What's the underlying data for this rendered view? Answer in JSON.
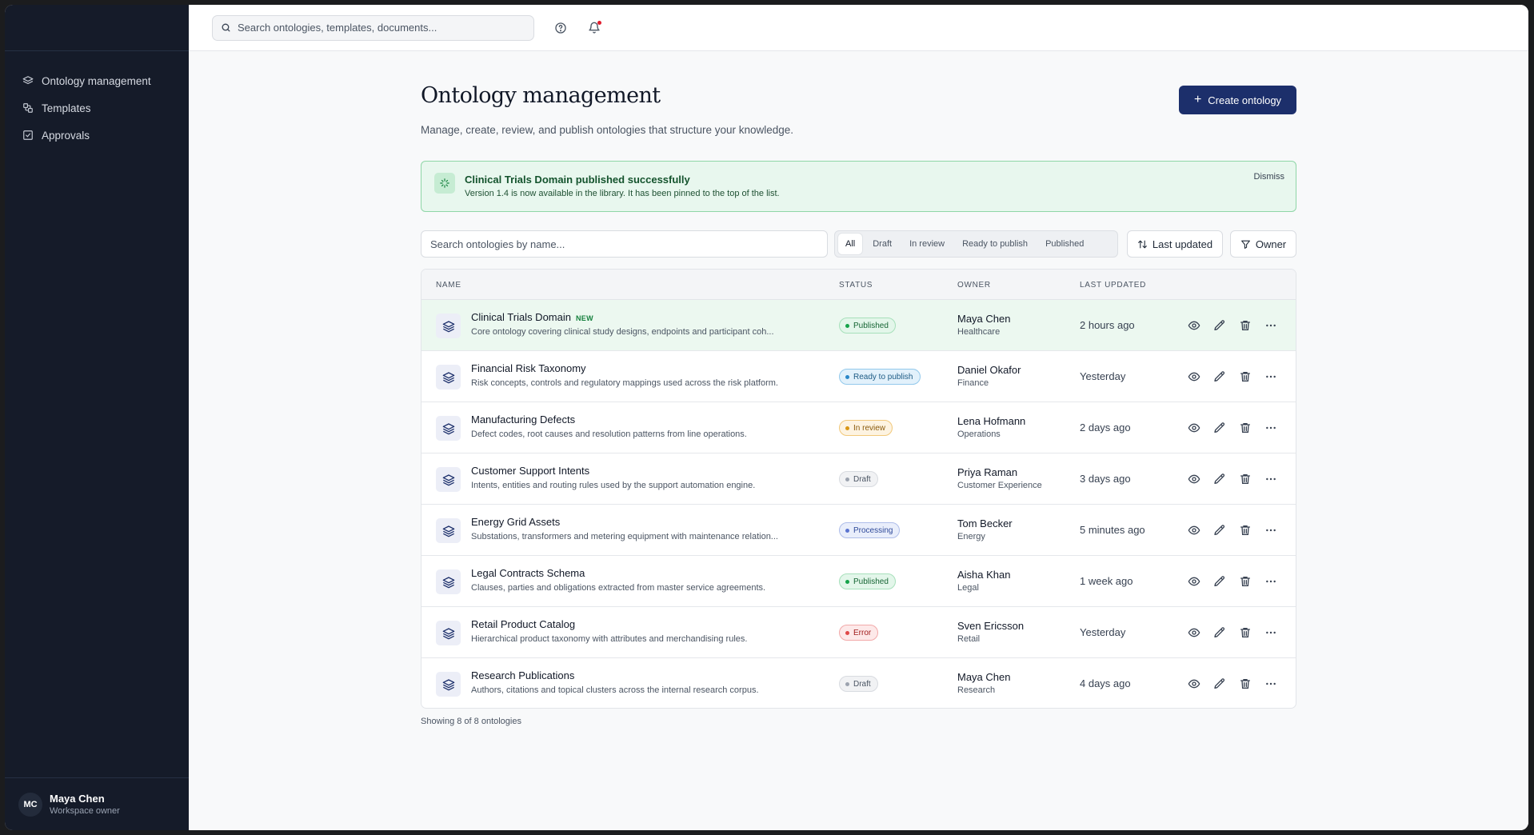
{
  "sidebar": {
    "items": [
      {
        "label": "Ontology management",
        "icon": "layers-icon"
      },
      {
        "label": "Templates",
        "icon": "template-icon"
      },
      {
        "label": "Approvals",
        "icon": "check-square-icon"
      }
    ],
    "user": {
      "initials": "MC",
      "name": "Maya Chen",
      "role": "Workspace owner"
    }
  },
  "topbar": {
    "search_placeholder": "Search ontologies, templates, documents...",
    "icons": [
      "help-icon",
      "bell-icon"
    ]
  },
  "page": {
    "title": "Ontology management",
    "subtitle": "Manage, create, review, and publish ontologies that structure your knowledge.",
    "create_label": "Create ontology"
  },
  "banner": {
    "title": "Clinical Trials Domain published successfully",
    "text": "Version 1.4 is now available in the library. It has been pinned to the top of the list.",
    "dismiss_label": "Dismiss"
  },
  "filters": {
    "search_placeholder": "Search ontologies by name...",
    "tabs": [
      "All",
      "Draft",
      "In review",
      "Ready to publish",
      "Published"
    ],
    "active_tab": "All",
    "sort_label": "Last updated",
    "owner_label": "Owner"
  },
  "table": {
    "columns": [
      "NAME",
      "STATUS",
      "OWNER",
      "LAST UPDATED"
    ],
    "rows": [
      {
        "name": "Clinical Trials Domain",
        "badge": "NEW",
        "description": "Core ontology covering clinical study designs, endpoints and participant coh...",
        "status": "Published",
        "owner": "Maya Chen",
        "dept": "Healthcare",
        "updated": "2 hours ago",
        "highlight": true
      },
      {
        "name": "Financial Risk Taxonomy",
        "badge": "",
        "description": "Risk concepts, controls and regulatory mappings used across the risk platform.",
        "status": "Ready to publish",
        "owner": "Daniel Okafor",
        "dept": "Finance",
        "updated": "Yesterday",
        "highlight": false
      },
      {
        "name": "Manufacturing Defects",
        "badge": "",
        "description": "Defect codes, root causes and resolution patterns from line operations.",
        "status": "In review",
        "owner": "Lena Hofmann",
        "dept": "Operations",
        "updated": "2 days ago",
        "highlight": false
      },
      {
        "name": "Customer Support Intents",
        "badge": "",
        "description": "Intents, entities and routing rules used by the support automation engine.",
        "status": "Draft",
        "owner": "Priya Raman",
        "dept": "Customer Experience",
        "updated": "3 days ago",
        "highlight": false
      },
      {
        "name": "Energy Grid Assets",
        "badge": "",
        "description": "Substations, transformers and metering equipment with maintenance relation...",
        "status": "Processing",
        "owner": "Tom Becker",
        "dept": "Energy",
        "updated": "5 minutes ago",
        "highlight": false
      },
      {
        "name": "Legal Contracts Schema",
        "badge": "",
        "description": "Clauses, parties and obligations extracted from master service agreements.",
        "status": "Published",
        "owner": "Aisha Khan",
        "dept": "Legal",
        "updated": "1 week ago",
        "highlight": false
      },
      {
        "name": "Retail Product Catalog",
        "badge": "",
        "description": "Hierarchical product taxonomy with attributes and merchandising rules.",
        "status": "Error",
        "owner": "Sven Ericsson",
        "dept": "Retail",
        "updated": "Yesterday",
        "highlight": false
      },
      {
        "name": "Research Publications",
        "badge": "",
        "description": "Authors, citations and topical clusters across the internal research corpus.",
        "status": "Draft",
        "owner": "Maya Chen",
        "dept": "Research",
        "updated": "4 days ago",
        "highlight": false
      }
    ],
    "row_actions": [
      "eye-icon",
      "pencil-icon",
      "trash-icon",
      "more-horizontal-icon"
    ]
  },
  "status_colors": {
    "Published": {
      "bg": "#e3f6ea",
      "border": "#a7e0bb",
      "text": "#166534",
      "dot": "#16a34a"
    },
    "Ready to publish": {
      "bg": "#e2f1fb",
      "border": "#93c9ec",
      "text": "#1d5b85",
      "dot": "#2b87c8"
    },
    "In review": {
      "bg": "#fdf3e1",
      "border": "#f1c87a",
      "text": "#8a5a0b",
      "dot": "#d99614"
    },
    "Draft": {
      "bg": "#f1f2f4",
      "border": "#d8dbe0",
      "text": "#4b5563",
      "dot": "#9ca3af"
    },
    "Processing": {
      "bg": "#e9eefb",
      "border": "#aebde9",
      "text": "#2f4a9a",
      "dot": "#5b74d0"
    },
    "Error": {
      "bg": "#fde9e9",
      "border": "#f2a9a9",
      "text": "#a11d1d",
      "dot": "#e04848"
    }
  },
  "footer": {
    "count_text": "Showing 8 of 8 ontologies"
  }
}
